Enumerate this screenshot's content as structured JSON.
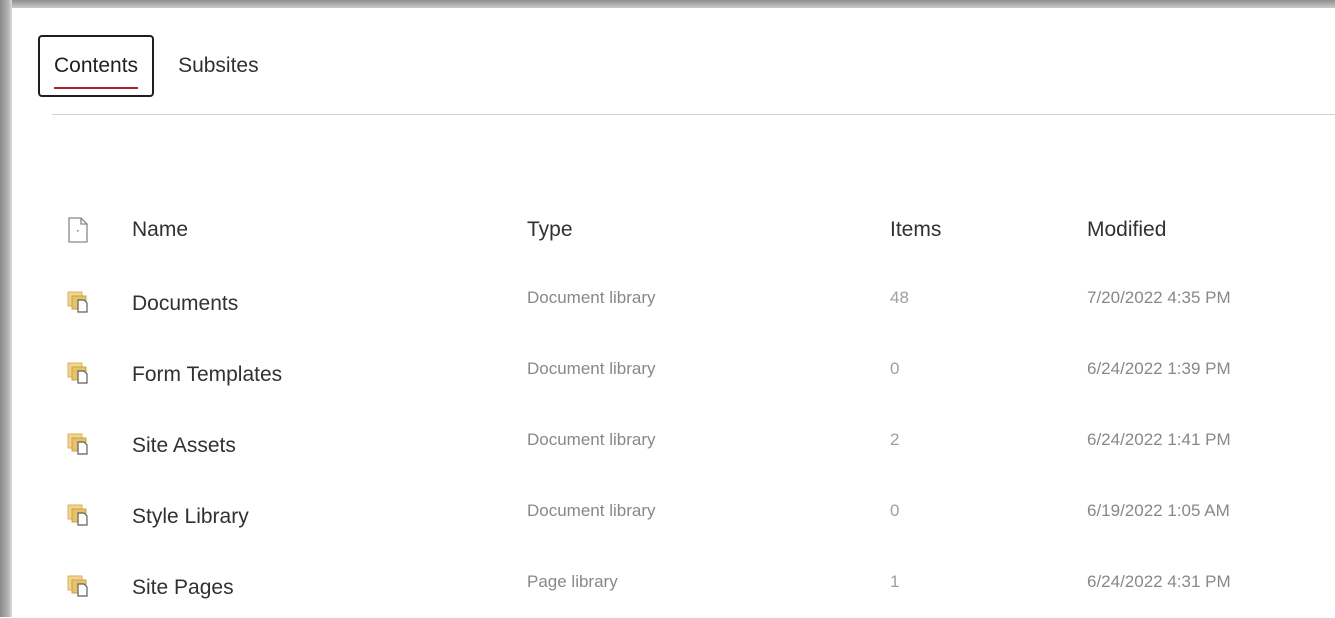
{
  "tabs": [
    {
      "label": "Contents",
      "active": true
    },
    {
      "label": "Subsites",
      "active": false
    }
  ],
  "table": {
    "headers": {
      "icon": "document-icon",
      "name": "Name",
      "type": "Type",
      "items": "Items",
      "modified": "Modified"
    },
    "rows": [
      {
        "icon": "library-icon",
        "name": "Documents",
        "type": "Document library",
        "items": "48",
        "modified": "7/20/2022 4:35 PM"
      },
      {
        "icon": "library-icon",
        "name": "Form Templates",
        "type": "Document library",
        "items": "0",
        "modified": "6/24/2022 1:39 PM"
      },
      {
        "icon": "library-icon",
        "name": "Site Assets",
        "type": "Document library",
        "items": "2",
        "modified": "6/24/2022 1:41 PM"
      },
      {
        "icon": "library-icon",
        "name": "Style Library",
        "type": "Document library",
        "items": "0",
        "modified": "6/19/2022 1:05 AM"
      },
      {
        "icon": "library-icon",
        "name": "Site Pages",
        "type": "Page library",
        "items": "1",
        "modified": "6/24/2022 4:31 PM"
      }
    ]
  },
  "colors": {
    "active_tab_underline": "#a4262c",
    "library_icon": "#e8c26a"
  }
}
